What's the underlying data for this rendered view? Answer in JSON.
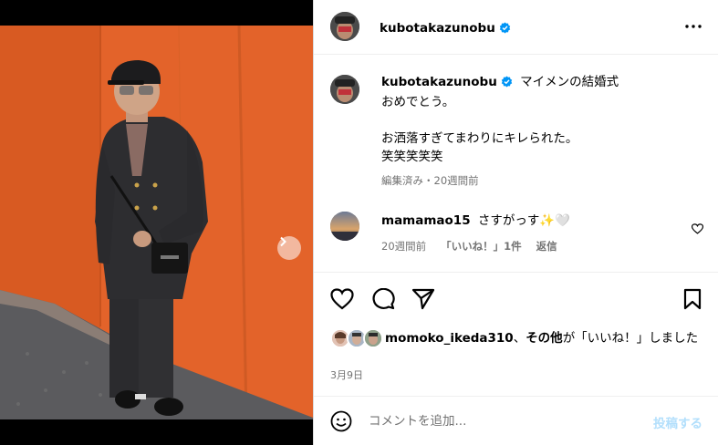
{
  "post": {
    "author": "kubotakazunobu",
    "more_icon": "more-horizontal-icon",
    "verified_icon": "verified-badge-icon"
  },
  "caption": {
    "author": "kubotakazunobu",
    "first_line": "マイメンの結婚式",
    "body": "おめでとう。\n\nお洒落すぎてまわりにキレられた。\n笑笑笑笑笑",
    "meta": "編集済み・20週間前"
  },
  "comment": {
    "author": "mamamao15",
    "text": "さすがっす✨🤍",
    "time": "20週間前",
    "likes": "「いいね！」1件",
    "reply": "返信"
  },
  "likes": {
    "user": "momoko_ikeda310",
    "separator": "、",
    "others": "その他",
    "suffix": "が「いいね！」しました"
  },
  "date": "3月9日",
  "add_comment": {
    "placeholder": "コメントを追加...",
    "post_label": "投稿する"
  },
  "media": {
    "slide_count": 2,
    "active_slide": 1
  },
  "colors": {
    "verified": "#0095f6",
    "secondary_text": "#737373",
    "post_button_disabled": "#b2dffc",
    "wall_orange": "#e8692c"
  }
}
